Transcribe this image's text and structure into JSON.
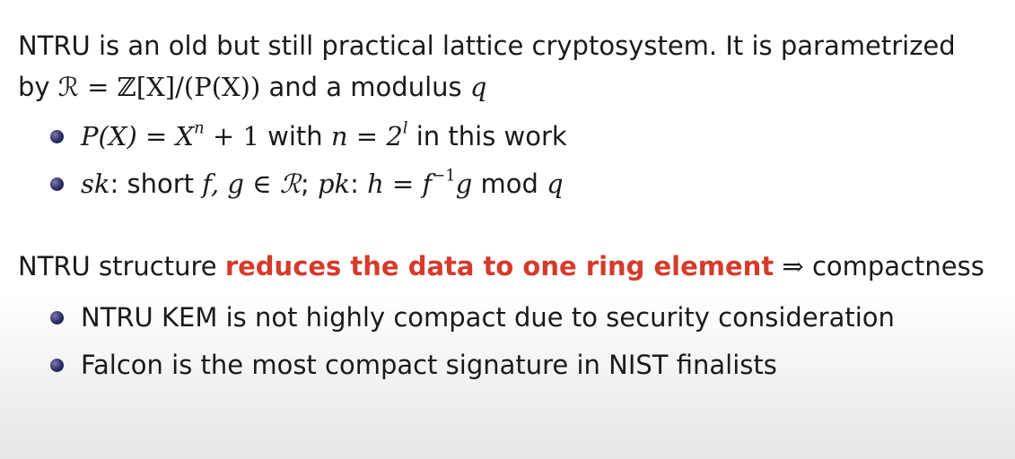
{
  "intro": {
    "line1": "NTRU is an old but still practical lattice cryptosystem. It is parametrized",
    "line2_a": "by ",
    "line2_math": "ℛ = ℤ[X]/(P(X))",
    "line2_b": " and a modulus ",
    "line2_q": "q"
  },
  "bullets_1": [
    {
      "math_a": "P(X) = X",
      "sup_n": "n",
      "math_b": " + 1",
      "text_a": " with ",
      "math_c": "n = 2",
      "sup_l": "l",
      "text_b": " in this work"
    },
    {
      "sk": "sk",
      "text_a": ": short ",
      "math_a": "f, g ∈ ℛ",
      "text_b": "; ",
      "pk": "pk",
      "text_c": ": ",
      "math_b": "h = f",
      "sup": "−1",
      "math_c": "g",
      "text_d": " mod ",
      "math_d": "q"
    }
  ],
  "structure": {
    "text_a": "NTRU structure ",
    "highlight": "reduces the data to one ring element",
    "arrow": " ⇒ ",
    "text_b": "compactness"
  },
  "bullets_2": [
    "NTRU KEM is not highly compact due to security consideration",
    "Falcon is the most compact signature in NIST finalists"
  ],
  "colors": {
    "highlight": "#d63a2a",
    "bullet": "#2a2a66"
  }
}
